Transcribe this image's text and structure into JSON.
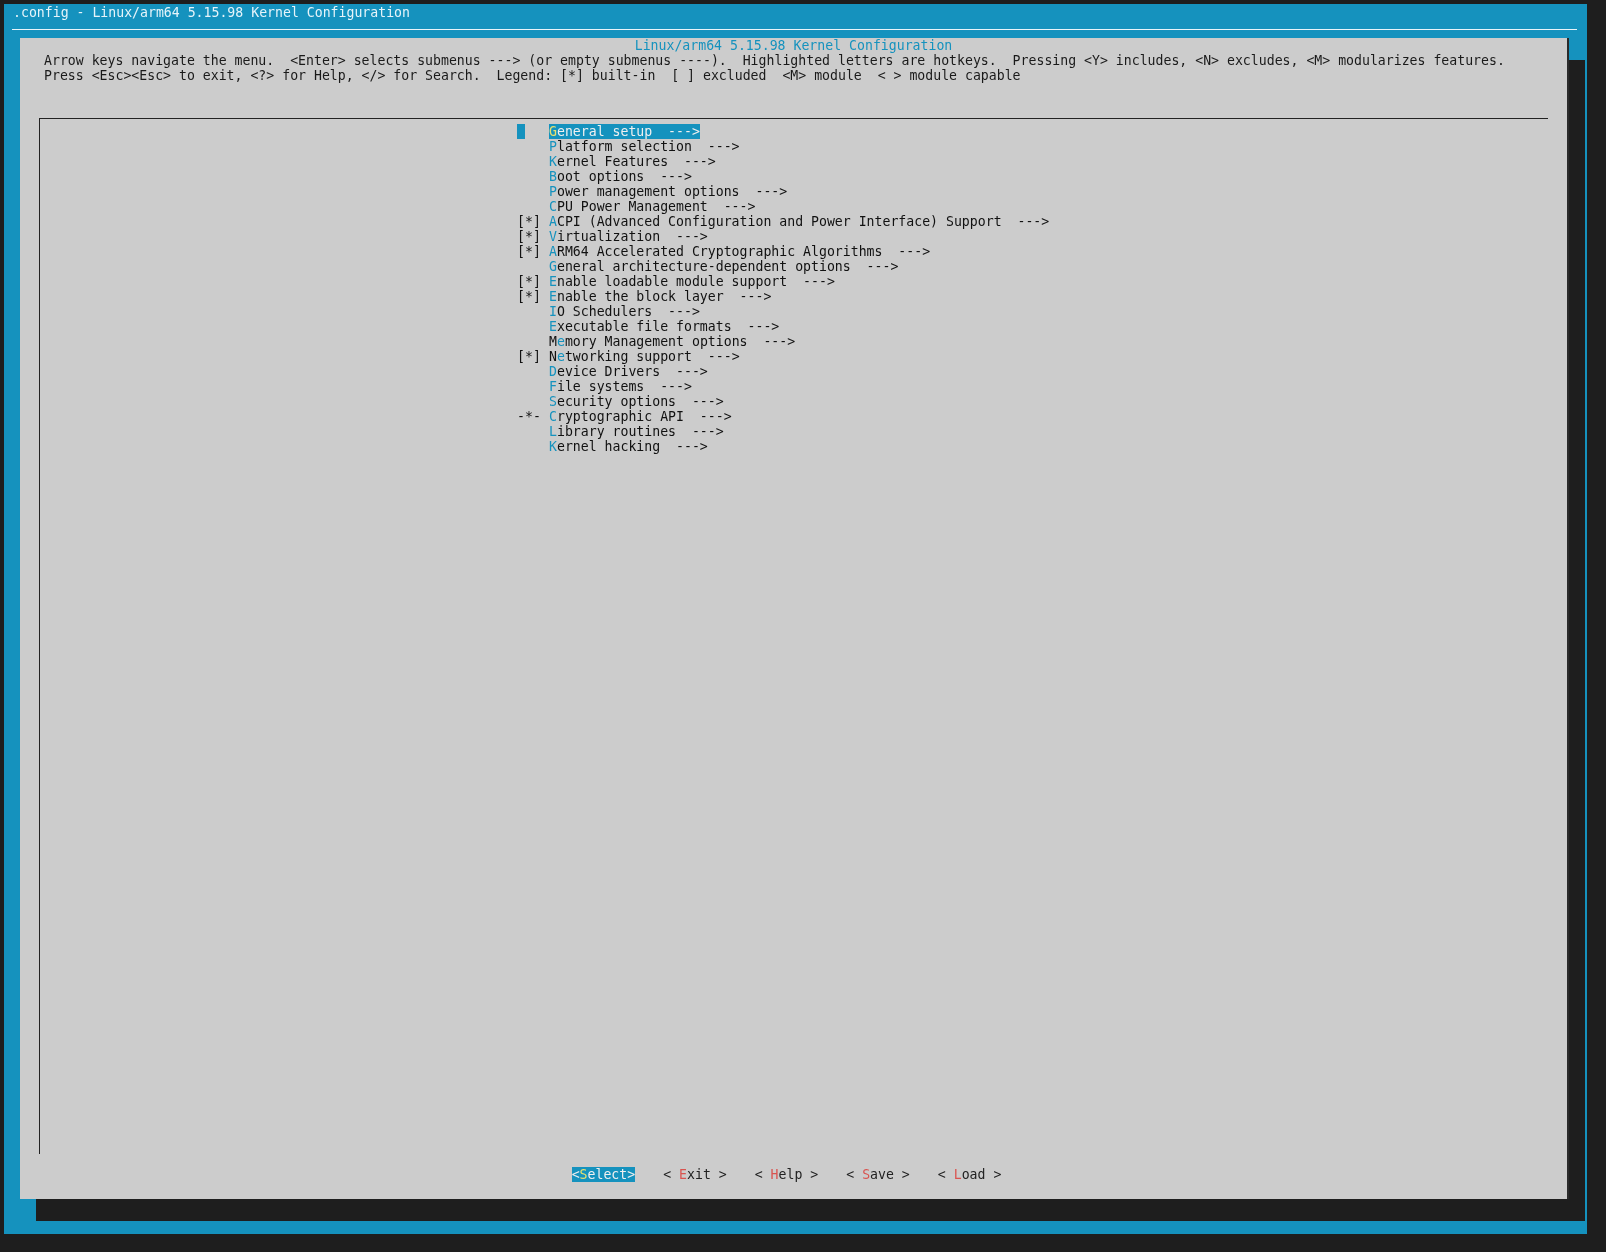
{
  "window": {
    "title": ".config - Linux/arm64 5.15.98 Kernel Configuration"
  },
  "dialog": {
    "title": "Linux/arm64 5.15.98 Kernel Configuration",
    "help_lines": [
      "Arrow keys navigate the menu.  <Enter> selects submenus ---> (or empty submenus ----).  Highlighted letters are hotkeys.  Pressing <Y> includes, <N> excludes, <M> modularizes features.",
      "Press <Esc><Esc> to exit, <?> for Help, </> for Search.  Legend: [*] built-in  [ ] excluded  <M> module  < > module capable"
    ]
  },
  "menu": [
    {
      "hotkey": "G",
      "rest": "eneral setup",
      "arrow": "--->",
      "selected": true
    },
    {
      "hotkey": "P",
      "rest": "latform selection",
      "arrow": "--->",
      "selected": false
    },
    {
      "hotkey": "K",
      "rest": "ernel Features",
      "arrow": "--->",
      "selected": false
    },
    {
      "hotkey": "B",
      "rest": "oot options",
      "arrow": "--->",
      "selected": false
    },
    {
      "hotkey": "P",
      "rest": "ower management options",
      "arrow": "--->",
      "selected": false
    },
    {
      "hotkey": "C",
      "rest": "PU Power Management",
      "arrow": "--->",
      "selected": false
    },
    {
      "marker": "[*]",
      "hotkey": "A",
      "rest": "CPI (Advanced Configuration and Power Interface) Support",
      "arrow": "--->",
      "selected": false
    },
    {
      "marker": "[*]",
      "hotkey": "V",
      "rest": "irtualization",
      "arrow": "--->",
      "selected": false
    },
    {
      "marker": "[*]",
      "hotkey": "A",
      "rest": "RM64 Accelerated Cryptographic Algorithms",
      "arrow": "--->",
      "selected": false
    },
    {
      "hotkey": "G",
      "rest": "eneral architecture-dependent options",
      "arrow": "--->",
      "selected": false
    },
    {
      "marker": "[*]",
      "hotkey": "E",
      "rest": "nable loadable module support",
      "arrow": "--->",
      "selected": false
    },
    {
      "marker": "[*]",
      "hotkey": "E",
      "rest": "nable the block layer",
      "arrow": "--->",
      "selected": false
    },
    {
      "hotkey": "I",
      "rest": "O Schedulers",
      "arrow": "--->",
      "selected": false
    },
    {
      "hotkey": "E",
      "rest": "xecutable file formats",
      "arrow": "--->",
      "selected": false
    },
    {
      "lead": "M",
      "hotkey": "e",
      "rest": "mory Management options",
      "arrow": "--->",
      "selected": false
    },
    {
      "marker": "[*]",
      "lead": "N",
      "hotkey": "e",
      "rest": "tworking support",
      "arrow": "--->",
      "selected": false
    },
    {
      "hotkey": "D",
      "rest": "evice Drivers",
      "arrow": "--->",
      "selected": false
    },
    {
      "hotkey": "F",
      "rest": "ile systems",
      "arrow": "--->",
      "selected": false
    },
    {
      "hotkey": "S",
      "rest": "ecurity options",
      "arrow": "--->",
      "selected": false
    },
    {
      "marker": "-*-",
      "hotkey": "C",
      "rest": "ryptographic API",
      "arrow": "--->",
      "selected": false
    },
    {
      "hotkey": "L",
      "rest": "ibrary routines",
      "arrow": "--->",
      "selected": false
    },
    {
      "hotkey": "K",
      "rest": "ernel hacking",
      "arrow": "--->",
      "selected": false
    }
  ],
  "buttons": [
    {
      "open": "<",
      "hotkey": "S",
      "rest": "elect",
      "close": ">",
      "selected": true
    },
    {
      "open": "<",
      "hotkey": "E",
      "rest": "xit",
      "close": ">",
      "selected": false
    },
    {
      "open": "<",
      "hotkey": "H",
      "rest": "elp",
      "close": ">",
      "selected": false
    },
    {
      "open": "<",
      "hotkey": "S",
      "rest": "ave",
      "close": ">",
      "selected": false
    },
    {
      "open": "<",
      "hotkey": "L",
      "rest": "oad",
      "close": ">",
      "selected": false
    }
  ]
}
